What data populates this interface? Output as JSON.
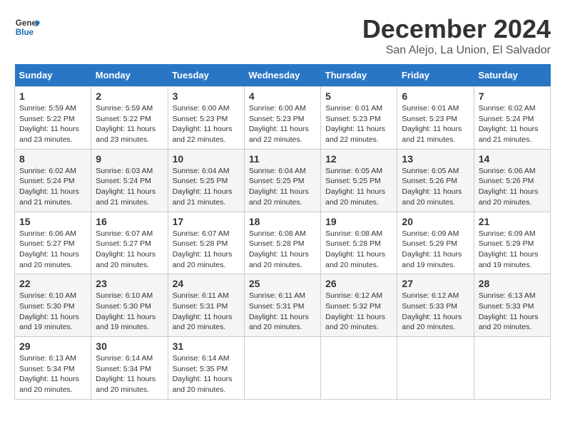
{
  "logo": {
    "text_general": "General",
    "text_blue": "Blue"
  },
  "title": "December 2024",
  "location": "San Alejo, La Union, El Salvador",
  "days_of_week": [
    "Sunday",
    "Monday",
    "Tuesday",
    "Wednesday",
    "Thursday",
    "Friday",
    "Saturday"
  ],
  "weeks": [
    [
      {
        "day": "1",
        "sunrise": "5:59 AM",
        "sunset": "5:22 PM",
        "daylight": "11 hours and 23 minutes"
      },
      {
        "day": "2",
        "sunrise": "5:59 AM",
        "sunset": "5:22 PM",
        "daylight": "11 hours and 23 minutes"
      },
      {
        "day": "3",
        "sunrise": "6:00 AM",
        "sunset": "5:23 PM",
        "daylight": "11 hours and 22 minutes"
      },
      {
        "day": "4",
        "sunrise": "6:00 AM",
        "sunset": "5:23 PM",
        "daylight": "11 hours and 22 minutes"
      },
      {
        "day": "5",
        "sunrise": "6:01 AM",
        "sunset": "5:23 PM",
        "daylight": "11 hours and 22 minutes"
      },
      {
        "day": "6",
        "sunrise": "6:01 AM",
        "sunset": "5:23 PM",
        "daylight": "11 hours and 21 minutes"
      },
      {
        "day": "7",
        "sunrise": "6:02 AM",
        "sunset": "5:24 PM",
        "daylight": "11 hours and 21 minutes"
      }
    ],
    [
      {
        "day": "8",
        "sunrise": "6:02 AM",
        "sunset": "5:24 PM",
        "daylight": "11 hours and 21 minutes"
      },
      {
        "day": "9",
        "sunrise": "6:03 AM",
        "sunset": "5:24 PM",
        "daylight": "11 hours and 21 minutes"
      },
      {
        "day": "10",
        "sunrise": "6:04 AM",
        "sunset": "5:25 PM",
        "daylight": "11 hours and 21 minutes"
      },
      {
        "day": "11",
        "sunrise": "6:04 AM",
        "sunset": "5:25 PM",
        "daylight": "11 hours and 20 minutes"
      },
      {
        "day": "12",
        "sunrise": "6:05 AM",
        "sunset": "5:25 PM",
        "daylight": "11 hours and 20 minutes"
      },
      {
        "day": "13",
        "sunrise": "6:05 AM",
        "sunset": "5:26 PM",
        "daylight": "11 hours and 20 minutes"
      },
      {
        "day": "14",
        "sunrise": "6:06 AM",
        "sunset": "5:26 PM",
        "daylight": "11 hours and 20 minutes"
      }
    ],
    [
      {
        "day": "15",
        "sunrise": "6:06 AM",
        "sunset": "5:27 PM",
        "daylight": "11 hours and 20 minutes"
      },
      {
        "day": "16",
        "sunrise": "6:07 AM",
        "sunset": "5:27 PM",
        "daylight": "11 hours and 20 minutes"
      },
      {
        "day": "17",
        "sunrise": "6:07 AM",
        "sunset": "5:28 PM",
        "daylight": "11 hours and 20 minutes"
      },
      {
        "day": "18",
        "sunrise": "6:08 AM",
        "sunset": "5:28 PM",
        "daylight": "11 hours and 20 minutes"
      },
      {
        "day": "19",
        "sunrise": "6:08 AM",
        "sunset": "5:28 PM",
        "daylight": "11 hours and 20 minutes"
      },
      {
        "day": "20",
        "sunrise": "6:09 AM",
        "sunset": "5:29 PM",
        "daylight": "11 hours and 19 minutes"
      },
      {
        "day": "21",
        "sunrise": "6:09 AM",
        "sunset": "5:29 PM",
        "daylight": "11 hours and 19 minutes"
      }
    ],
    [
      {
        "day": "22",
        "sunrise": "6:10 AM",
        "sunset": "5:30 PM",
        "daylight": "11 hours and 19 minutes"
      },
      {
        "day": "23",
        "sunrise": "6:10 AM",
        "sunset": "5:30 PM",
        "daylight": "11 hours and 19 minutes"
      },
      {
        "day": "24",
        "sunrise": "6:11 AM",
        "sunset": "5:31 PM",
        "daylight": "11 hours and 20 minutes"
      },
      {
        "day": "25",
        "sunrise": "6:11 AM",
        "sunset": "5:31 PM",
        "daylight": "11 hours and 20 minutes"
      },
      {
        "day": "26",
        "sunrise": "6:12 AM",
        "sunset": "5:32 PM",
        "daylight": "11 hours and 20 minutes"
      },
      {
        "day": "27",
        "sunrise": "6:12 AM",
        "sunset": "5:33 PM",
        "daylight": "11 hours and 20 minutes"
      },
      {
        "day": "28",
        "sunrise": "6:13 AM",
        "sunset": "5:33 PM",
        "daylight": "11 hours and 20 minutes"
      }
    ],
    [
      {
        "day": "29",
        "sunrise": "6:13 AM",
        "sunset": "5:34 PM",
        "daylight": "11 hours and 20 minutes"
      },
      {
        "day": "30",
        "sunrise": "6:14 AM",
        "sunset": "5:34 PM",
        "daylight": "11 hours and 20 minutes"
      },
      {
        "day": "31",
        "sunrise": "6:14 AM",
        "sunset": "5:35 PM",
        "daylight": "11 hours and 20 minutes"
      },
      null,
      null,
      null,
      null
    ]
  ]
}
